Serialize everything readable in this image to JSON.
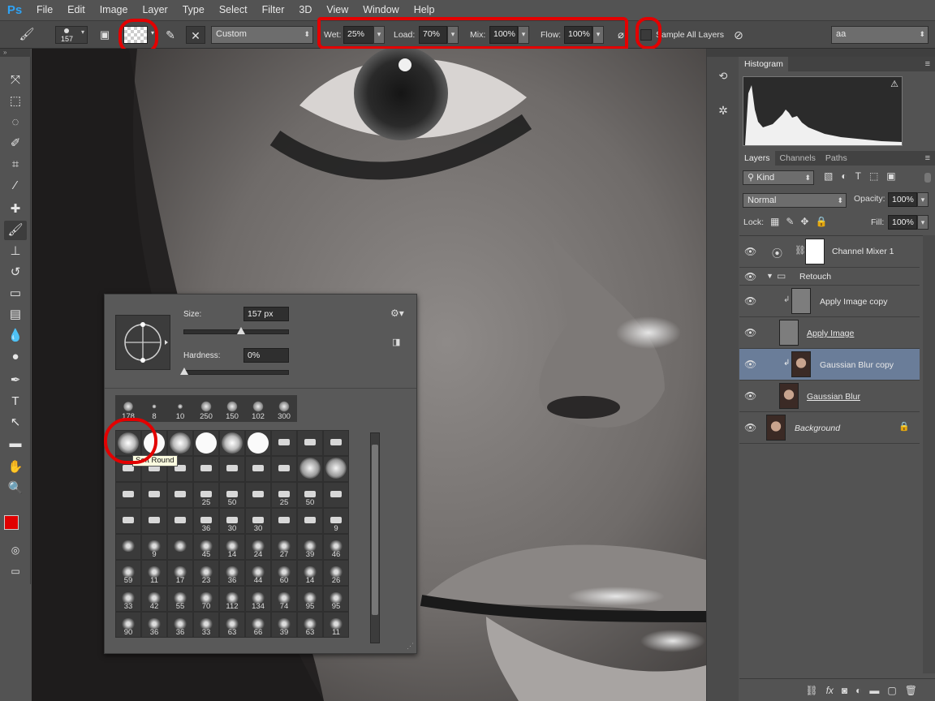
{
  "app": {
    "logo": "Ps"
  },
  "menu": [
    "File",
    "Edit",
    "Image",
    "Layer",
    "Type",
    "Select",
    "Filter",
    "3D",
    "View",
    "Window",
    "Help"
  ],
  "options": {
    "brush_size": "157",
    "preset": "Custom",
    "wet_label": "Wet:",
    "wet_value": "25%",
    "load_label": "Load:",
    "load_value": "70%",
    "mix_label": "Mix:",
    "mix_value": "100%",
    "flow_label": "Flow:",
    "flow_value": "100%",
    "sample_all_layers": "Sample All Layers",
    "workspace": "aa"
  },
  "picker": {
    "size_label": "Size:",
    "size_value": "157 px",
    "hardness_label": "Hardness:",
    "hardness_value": "0%",
    "size_level": 0.55,
    "hardness_level": 0.0,
    "recent": [
      "178",
      "8",
      "10",
      "250",
      "150",
      "102",
      "300"
    ],
    "tooltip": "Soft Round",
    "grid_labels": [
      [
        "",
        "",
        "",
        "",
        "",
        "",
        "",
        "",
        "",
        ""
      ],
      [
        "",
        "",
        "",
        "",
        "",
        "",
        "",
        "",
        "",
        ""
      ],
      [
        "",
        "",
        "",
        "25",
        "50",
        "",
        "25",
        "50",
        "",
        ""
      ],
      [
        "",
        "",
        "",
        "36",
        "30",
        "30",
        "",
        "",
        "9",
        ""
      ],
      [
        "",
        "9",
        "",
        "45",
        "14",
        "24",
        "27",
        "39",
        "46",
        ""
      ],
      [
        "59",
        "11",
        "17",
        "23",
        "36",
        "44",
        "60",
        "14",
        "26",
        ""
      ],
      [
        "33",
        "42",
        "55",
        "70",
        "112",
        "134",
        "74",
        "95",
        "95",
        ""
      ],
      [
        "90",
        "36",
        "36",
        "33",
        "63",
        "66",
        "39",
        "63",
        "11",
        ""
      ]
    ]
  },
  "histogram": {
    "title": "Histogram"
  },
  "layers_panel": {
    "tabs": [
      "Layers",
      "Channels",
      "Paths"
    ],
    "kind": "Kind",
    "blend_mode": "Normal",
    "opacity_label": "Opacity:",
    "opacity_value": "100%",
    "lock_label": "Lock:",
    "fill_label": "Fill:",
    "fill_value": "100%",
    "layers": [
      {
        "name": "Channel Mixer 1"
      },
      {
        "name": "Retouch"
      },
      {
        "name": "Apply Image copy"
      },
      {
        "name": "Apply Image"
      },
      {
        "name": "Gaussian Blur copy"
      },
      {
        "name": "Gaussian Blur"
      },
      {
        "name": "Background"
      }
    ]
  },
  "colors": {
    "foreground": "#e00000",
    "background": "#000000",
    "selection": "#6a7d99",
    "annotation": "#e30000"
  }
}
